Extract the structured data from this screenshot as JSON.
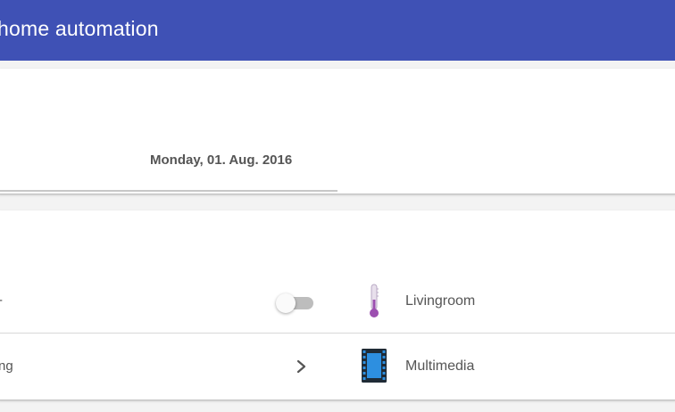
{
  "header": {
    "title": "home automation",
    "color": "#3f51b5"
  },
  "date_card": {
    "date": "Monday, 01. Aug. 2016"
  },
  "devices": {
    "rows": [
      {
        "left_fragment": "-",
        "control": "toggle",
        "toggle_on": false,
        "icon": "thermometer-icon",
        "label": "Livingroom"
      },
      {
        "left_fragment": "ng",
        "control": "chevron-right",
        "icon": "film-icon",
        "label": "Multimedia"
      }
    ]
  }
}
